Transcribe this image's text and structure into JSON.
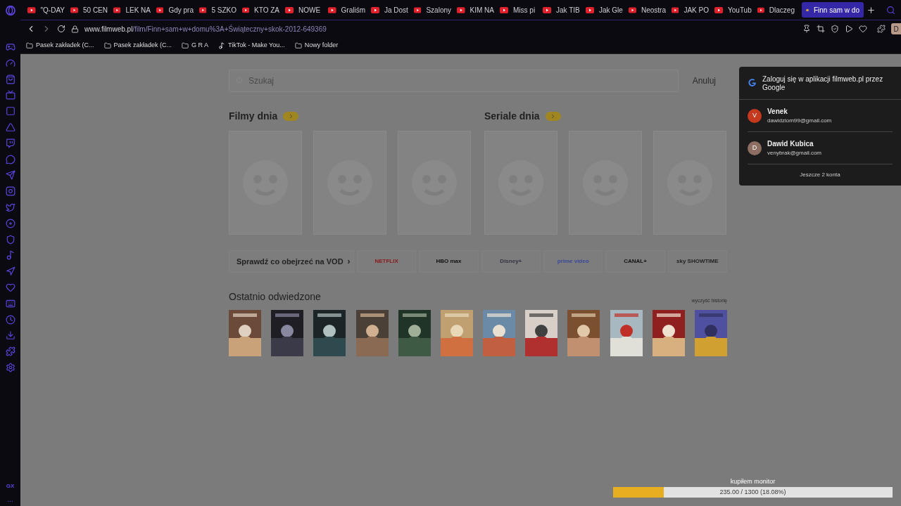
{
  "tabs": [
    {
      "label": "\"Q-DAY",
      "kind": "youtube",
      "selected": false
    },
    {
      "label": "50 CEN",
      "kind": "youtube",
      "selected": false
    },
    {
      "label": "LEK NA",
      "kind": "youtube",
      "selected": false
    },
    {
      "label": "Gdy pra",
      "kind": "youtube",
      "selected": false
    },
    {
      "label": "5 SZKO",
      "kind": "youtube",
      "selected": false
    },
    {
      "label": "KTO ZA",
      "kind": "youtube",
      "selected": false
    },
    {
      "label": "NOWE",
      "kind": "youtube",
      "selected": false
    },
    {
      "label": "Graliśm",
      "kind": "youtube",
      "selected": false
    },
    {
      "label": "Ja Dost",
      "kind": "youtube",
      "selected": false
    },
    {
      "label": "Szalony",
      "kind": "youtube",
      "selected": false
    },
    {
      "label": "KIM NA",
      "kind": "youtube",
      "selected": false
    },
    {
      "label": "Miss pi",
      "kind": "youtube",
      "selected": false
    },
    {
      "label": "Jak TIB",
      "kind": "youtube",
      "selected": false
    },
    {
      "label": "Jak Gle",
      "kind": "youtube",
      "selected": false
    },
    {
      "label": "Neostra",
      "kind": "youtube",
      "selected": false
    },
    {
      "label": "JAK PO",
      "kind": "youtube",
      "selected": false
    },
    {
      "label": "YouTub",
      "kind": "youtube",
      "selected": false
    },
    {
      "label": "Dlaczeg",
      "kind": "youtube",
      "selected": false
    },
    {
      "label": "Finn sam w do",
      "kind": "filmweb",
      "selected": true
    }
  ],
  "address": {
    "domain": "www.filmweb.pl",
    "path": "/film/Finn+sam+w+domu%3A+Świąteczny+skok-2012-649369"
  },
  "profile_initial": "D",
  "bookmarks": [
    {
      "label": "Pasek zakładek (C...",
      "kind": "folder"
    },
    {
      "label": "Pasek zakładek (C...",
      "kind": "folder"
    },
    {
      "label": "G R A",
      "kind": "folder"
    },
    {
      "label": "TikTok - Make You...",
      "kind": "tiktok"
    },
    {
      "label": "Nowy folder",
      "kind": "folder"
    }
  ],
  "sidebar_footer": {
    "brand": "GX",
    "more": "..."
  },
  "search": {
    "placeholder": "Szukaj",
    "cancel": "Anuluj"
  },
  "sections": [
    {
      "title": "Filmy dnia",
      "cards": [
        {
          "kind": "placeholder"
        },
        {
          "kind": "placeholder"
        },
        {
          "kind": "placeholder"
        }
      ]
    },
    {
      "title": "Seriale dnia",
      "cards": [
        {
          "kind": "placeholder"
        },
        {
          "kind": "placeholder"
        },
        {
          "kind": "placeholder"
        }
      ]
    }
  ],
  "vod": {
    "label": "Sprawdź co obejrzeć na VOD",
    "arrow": "›",
    "services": [
      "NETFLIX",
      "HBO max",
      "Disney+",
      "prime video",
      "CANAL+",
      "sky SHOWTIME"
    ]
  },
  "recent": {
    "title": "Ostatnio odwiedzone",
    "clear": "wyczyść historię"
  },
  "google_popup": {
    "title": "Zaloguj się w aplikacji filmweb.pl przez Google",
    "accounts": [
      {
        "initial": "V",
        "name": "Venek",
        "email": "dawidziom99@gmail.com",
        "color": "#c5391f"
      },
      {
        "initial": "D",
        "name": "Dawid Kubica",
        "email": "venybrak@gmail.com",
        "color": "#8d6e63"
      }
    ],
    "more": "Jeszcze 2 konta"
  },
  "goal": {
    "title": "kupiłem monitor",
    "reading": "235.00 / 1300 (18.08%)",
    "level": 0.1808
  }
}
